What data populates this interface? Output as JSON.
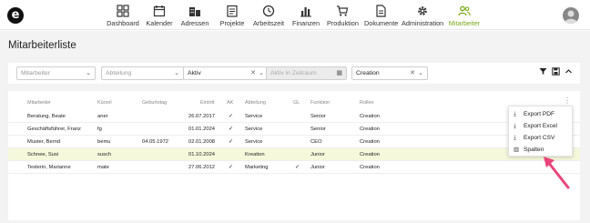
{
  "app": {
    "logo": "e",
    "nav": [
      {
        "label": "Dashboard",
        "icon": "dashboard-icon",
        "active": false
      },
      {
        "label": "Kalender",
        "icon": "calendar-icon",
        "active": false
      },
      {
        "label": "Adressen",
        "icon": "buildings-icon",
        "active": false
      },
      {
        "label": "Projekte",
        "icon": "projects-icon",
        "active": false
      },
      {
        "label": "Arbeitszeit",
        "icon": "clock-icon",
        "active": false
      },
      {
        "label": "Finanzen",
        "icon": "bar-chart-icon",
        "active": false
      },
      {
        "label": "Produktion",
        "icon": "cart-icon",
        "active": false
      },
      {
        "label": "Dokumente",
        "icon": "document-icon",
        "active": false
      },
      {
        "label": "Administration",
        "icon": "gear-icon",
        "active": false
      },
      {
        "label": "Mitarbeiter",
        "icon": "users-icon",
        "active": true
      }
    ],
    "accent": "#7aa816"
  },
  "page": {
    "title": "Mitarbeiterliste"
  },
  "filters": {
    "mitarbeiter_placeholder": "Mitarbeiter",
    "abteilung_placeholder": "Abteilung",
    "status_value": "Aktiv",
    "zeitraum_placeholder": "Aktiv in Zeitraum",
    "funktion_value": "Creation"
  },
  "table": {
    "headers": {
      "mitarbeiter": "Mitarbeiter",
      "kuerzel": "Kürzel",
      "geburtstag": "Geburtstag",
      "eintritt": "Eintritt",
      "ak": "AK",
      "abteilung": "Abteilung",
      "gl": "GL",
      "funktion": "Funktion",
      "rollen": "Rollen"
    },
    "rows": [
      {
        "name": "Beratung, Beate",
        "kuerzel": "aner",
        "geburtstag": "",
        "eintritt": "26.07.2017",
        "ak": "✓",
        "abteilung": "Service",
        "gl": "",
        "funktion": "Senior",
        "rollen": "Creation",
        "selected": false
      },
      {
        "name": "Geschäftsführer, Franz",
        "kuerzel": "fg",
        "geburtstag": "",
        "eintritt": "01.01.2024",
        "ak": "✓",
        "abteilung": "Service",
        "gl": "",
        "funktion": "Senior",
        "rollen": "Creation",
        "selected": false
      },
      {
        "name": "Muster, Bernd",
        "kuerzel": "bemu",
        "geburtstag": "04.05.1972",
        "eintritt": "02.01.2008",
        "ak": "✓",
        "abteilung": "Service",
        "gl": "",
        "funktion": "CEO",
        "rollen": "Creation",
        "selected": false
      },
      {
        "name": "Schnee, Susi",
        "kuerzel": "susch",
        "geburtstag": "",
        "eintritt": "01.10.2024",
        "ak": "",
        "abteilung": "Kreation",
        "gl": "",
        "funktion": "Junior",
        "rollen": "Creation",
        "selected": true
      },
      {
        "name": "Testerin, Marianne",
        "kuerzel": "mate",
        "geburtstag": "",
        "eintritt": "27.06.2012",
        "ak": "✓",
        "abteilung": "Marketing",
        "gl": "✓",
        "funktion": "Junior",
        "rollen": "Creation",
        "selected": false
      }
    ]
  },
  "export_menu": {
    "items": [
      {
        "label": "Export PDF",
        "icon": "download-icon"
      },
      {
        "label": "Export Excel",
        "icon": "download-icon"
      },
      {
        "label": "Export CSV",
        "icon": "download-icon"
      },
      {
        "label": "Spalten",
        "icon": "columns-icon"
      }
    ]
  }
}
